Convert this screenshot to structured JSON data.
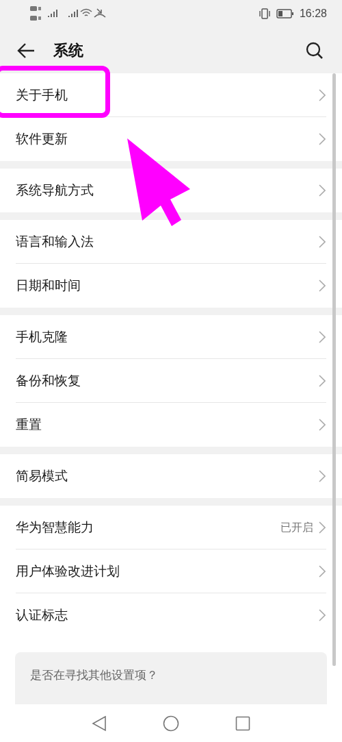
{
  "status_bar": {
    "time": "16:28"
  },
  "header": {
    "title": "系统"
  },
  "groups": [
    {
      "items": [
        {
          "label": "关于手机"
        },
        {
          "label": "软件更新"
        }
      ]
    },
    {
      "items": [
        {
          "label": "系统导航方式"
        }
      ]
    },
    {
      "items": [
        {
          "label": "语言和输入法"
        },
        {
          "label": "日期和时间"
        }
      ]
    },
    {
      "items": [
        {
          "label": "手机克隆"
        },
        {
          "label": "备份和恢复"
        },
        {
          "label": "重置"
        }
      ]
    },
    {
      "items": [
        {
          "label": "简易模式"
        }
      ]
    },
    {
      "items": [
        {
          "label": "华为智慧能力",
          "value": "已开启"
        },
        {
          "label": "用户体验改进计划"
        },
        {
          "label": "认证标志"
        }
      ]
    }
  ],
  "card": {
    "text": "是否在寻找其他设置项？"
  },
  "annotations": {
    "highlight_frame": true,
    "pointer_arrow": true
  }
}
